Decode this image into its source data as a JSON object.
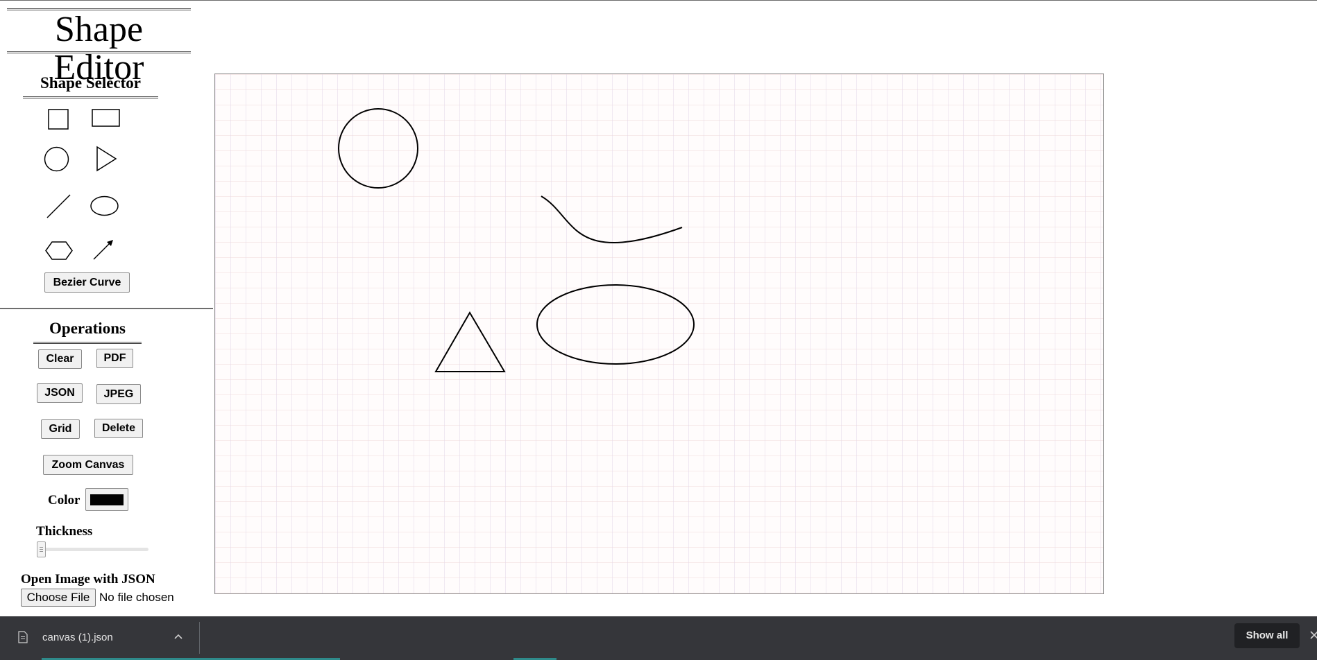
{
  "app": {
    "title": "Shape Editor"
  },
  "shape_selector": {
    "heading": "Shape Selector",
    "tools": [
      "square-icon",
      "rectangle-icon",
      "circle-icon",
      "triangle-icon",
      "line-icon",
      "ellipse-icon",
      "hexagon-icon",
      "arrow-icon"
    ],
    "bezier_label": "Bezier Curve"
  },
  "operations": {
    "heading": "Operations",
    "clear_label": "Clear",
    "pdf_label": "PDF",
    "json_label": "JSON",
    "jpeg_label": "JPEG",
    "grid_label": "Grid",
    "delete_label": "Delete",
    "zoom_label": "Zoom Canvas",
    "color_label": "Color",
    "color_value": "#000000",
    "thickness_label": "Thickness",
    "thickness_level": 0,
    "open_label": "Open Image with JSON",
    "choose_file_label": "Choose File",
    "file_status": "No file chosen"
  },
  "canvas": {
    "grid": true,
    "stroke_color": "#000000",
    "shapes": [
      "circle",
      "bezier-curve",
      "triangle",
      "ellipse"
    ]
  },
  "download_bar": {
    "file_name": "canvas (1).json",
    "show_all_label": "Show all",
    "icons": [
      "file-icon",
      "chevron-up-icon",
      "close-icon"
    ]
  }
}
